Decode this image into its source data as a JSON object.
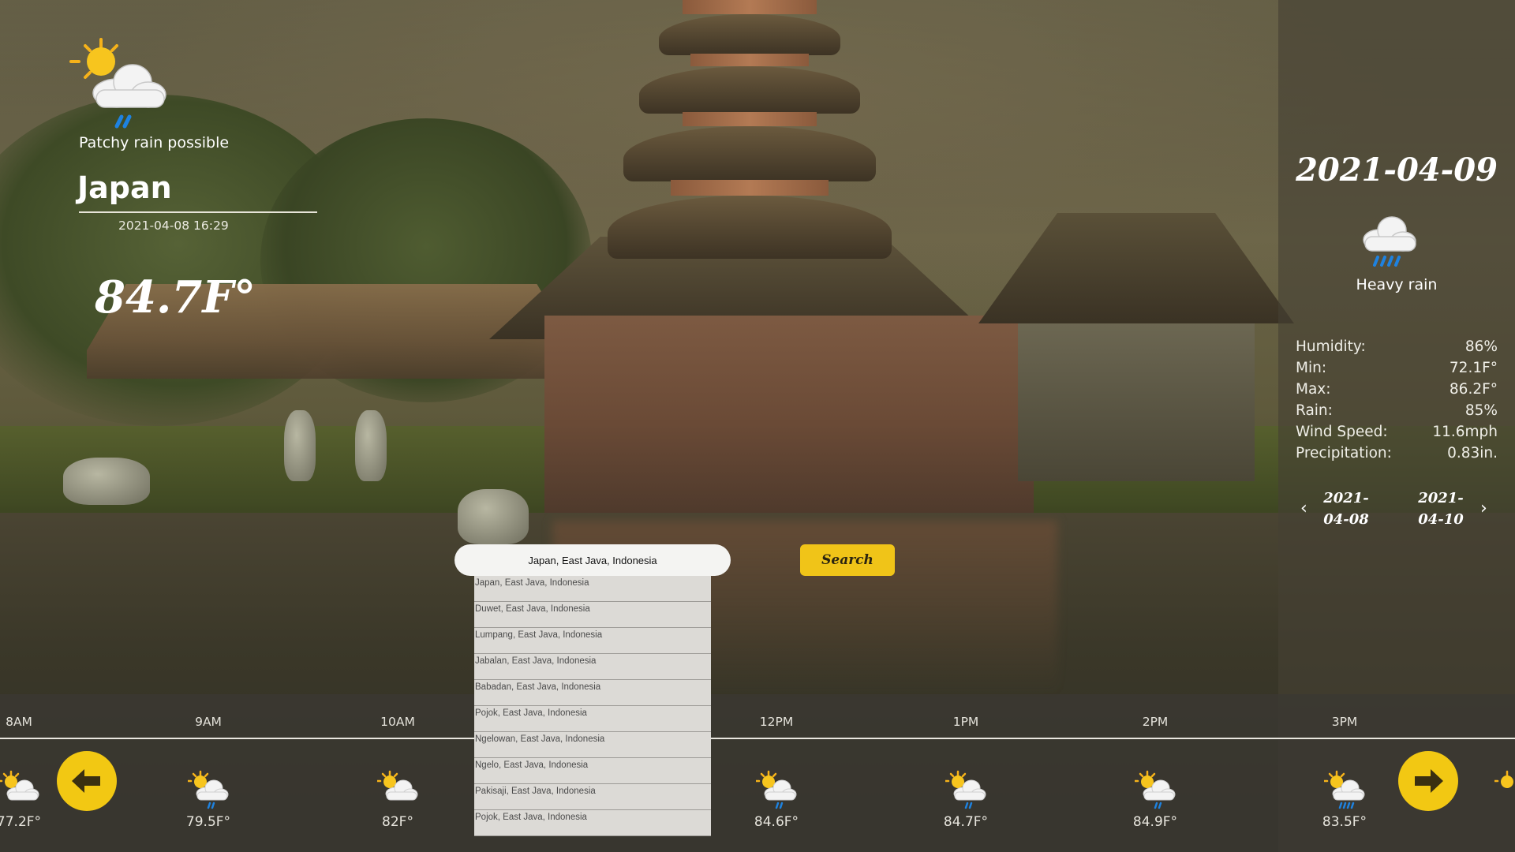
{
  "current": {
    "condition": "Patchy rain possible",
    "icon": "sun-cloud-rain-icon",
    "city": "Japan",
    "datetime": "2021-04-08 16:29",
    "temperature": "84.7F°"
  },
  "search": {
    "value": "Japan, East Java, Indonesia",
    "button_label": "Search",
    "suggestions": [
      "Japan, East Java, Indonesia",
      "Duwet, East Java, Indonesia",
      "Lumpang, East Java, Indonesia",
      "Jabalan, East Java, Indonesia",
      "Babadan, East Java, Indonesia",
      "Pojok, East Java, Indonesia",
      "Ngelowan, East Java, Indonesia",
      "Ngelo, East Java, Indonesia",
      "Pakisaji, East Java, Indonesia",
      "Pojok, East Java, Indonesia"
    ]
  },
  "forecast": {
    "date": "2021-04-09",
    "icon": "heavy-rain-icon",
    "condition": "Heavy rain",
    "stats": [
      {
        "label": "Humidity:",
        "value": "86%"
      },
      {
        "label": "Min:",
        "value": "72.1F°"
      },
      {
        "label": "Max:",
        "value": "86.2F°"
      },
      {
        "label": "Rain:",
        "value": "85%"
      },
      {
        "label": "Wind Speed:",
        "value": "11.6mph"
      },
      {
        "label": "Precipitation:",
        "value": "0.83in."
      }
    ],
    "prev_day": "2021-\n04-08",
    "next_day": "2021-\n04-10",
    "prev_day_line1": "2021-",
    "prev_day_line2": "04-08",
    "next_day_line1": "2021-",
    "next_day_line2": "04-10"
  },
  "hourly": [
    {
      "time": "8AM",
      "temp": "77.2F°",
      "icon": "sun-cloud-icon"
    },
    {
      "time": "9AM",
      "temp": "79.5F°",
      "icon": "sun-cloud-rain-icon"
    },
    {
      "time": "10AM",
      "temp": "82F°",
      "icon": "sun-cloud-icon"
    },
    {
      "time": "12PM",
      "temp": "84.6F°",
      "icon": "sun-cloud-rain-icon"
    },
    {
      "time": "1PM",
      "temp": "84.7F°",
      "icon": "sun-cloud-rain-icon"
    },
    {
      "time": "2PM",
      "temp": "84.9F°",
      "icon": "sun-cloud-rain-icon"
    },
    {
      "time": "3PM",
      "temp": "83.5F°",
      "icon": "sun-cloud-heavy-rain-icon"
    }
  ],
  "colors": {
    "accent": "#f2c813",
    "panel": "#46403a"
  }
}
